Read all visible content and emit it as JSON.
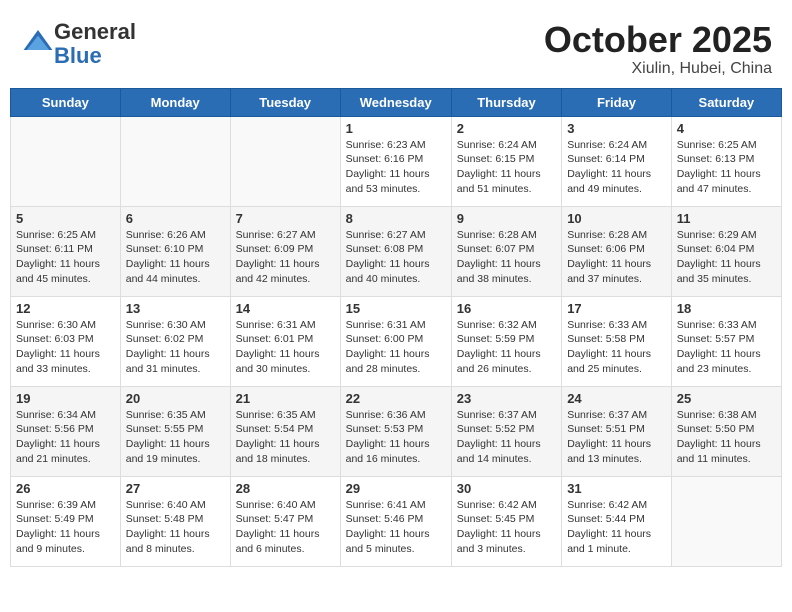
{
  "header": {
    "logo_general": "General",
    "logo_blue": "Blue",
    "title": "October 2025",
    "subtitle": "Xiulin, Hubei, China"
  },
  "weekdays": [
    "Sunday",
    "Monday",
    "Tuesday",
    "Wednesday",
    "Thursday",
    "Friday",
    "Saturday"
  ],
  "weeks": [
    [
      {
        "day": null,
        "info": null
      },
      {
        "day": null,
        "info": null
      },
      {
        "day": null,
        "info": null
      },
      {
        "day": "1",
        "info": "Sunrise: 6:23 AM\nSunset: 6:16 PM\nDaylight: 11 hours\nand 53 minutes."
      },
      {
        "day": "2",
        "info": "Sunrise: 6:24 AM\nSunset: 6:15 PM\nDaylight: 11 hours\nand 51 minutes."
      },
      {
        "day": "3",
        "info": "Sunrise: 6:24 AM\nSunset: 6:14 PM\nDaylight: 11 hours\nand 49 minutes."
      },
      {
        "day": "4",
        "info": "Sunrise: 6:25 AM\nSunset: 6:13 PM\nDaylight: 11 hours\nand 47 minutes."
      }
    ],
    [
      {
        "day": "5",
        "info": "Sunrise: 6:25 AM\nSunset: 6:11 PM\nDaylight: 11 hours\nand 45 minutes."
      },
      {
        "day": "6",
        "info": "Sunrise: 6:26 AM\nSunset: 6:10 PM\nDaylight: 11 hours\nand 44 minutes."
      },
      {
        "day": "7",
        "info": "Sunrise: 6:27 AM\nSunset: 6:09 PM\nDaylight: 11 hours\nand 42 minutes."
      },
      {
        "day": "8",
        "info": "Sunrise: 6:27 AM\nSunset: 6:08 PM\nDaylight: 11 hours\nand 40 minutes."
      },
      {
        "day": "9",
        "info": "Sunrise: 6:28 AM\nSunset: 6:07 PM\nDaylight: 11 hours\nand 38 minutes."
      },
      {
        "day": "10",
        "info": "Sunrise: 6:28 AM\nSunset: 6:06 PM\nDaylight: 11 hours\nand 37 minutes."
      },
      {
        "day": "11",
        "info": "Sunrise: 6:29 AM\nSunset: 6:04 PM\nDaylight: 11 hours\nand 35 minutes."
      }
    ],
    [
      {
        "day": "12",
        "info": "Sunrise: 6:30 AM\nSunset: 6:03 PM\nDaylight: 11 hours\nand 33 minutes."
      },
      {
        "day": "13",
        "info": "Sunrise: 6:30 AM\nSunset: 6:02 PM\nDaylight: 11 hours\nand 31 minutes."
      },
      {
        "day": "14",
        "info": "Sunrise: 6:31 AM\nSunset: 6:01 PM\nDaylight: 11 hours\nand 30 minutes."
      },
      {
        "day": "15",
        "info": "Sunrise: 6:31 AM\nSunset: 6:00 PM\nDaylight: 11 hours\nand 28 minutes."
      },
      {
        "day": "16",
        "info": "Sunrise: 6:32 AM\nSunset: 5:59 PM\nDaylight: 11 hours\nand 26 minutes."
      },
      {
        "day": "17",
        "info": "Sunrise: 6:33 AM\nSunset: 5:58 PM\nDaylight: 11 hours\nand 25 minutes."
      },
      {
        "day": "18",
        "info": "Sunrise: 6:33 AM\nSunset: 5:57 PM\nDaylight: 11 hours\nand 23 minutes."
      }
    ],
    [
      {
        "day": "19",
        "info": "Sunrise: 6:34 AM\nSunset: 5:56 PM\nDaylight: 11 hours\nand 21 minutes."
      },
      {
        "day": "20",
        "info": "Sunrise: 6:35 AM\nSunset: 5:55 PM\nDaylight: 11 hours\nand 19 minutes."
      },
      {
        "day": "21",
        "info": "Sunrise: 6:35 AM\nSunset: 5:54 PM\nDaylight: 11 hours\nand 18 minutes."
      },
      {
        "day": "22",
        "info": "Sunrise: 6:36 AM\nSunset: 5:53 PM\nDaylight: 11 hours\nand 16 minutes."
      },
      {
        "day": "23",
        "info": "Sunrise: 6:37 AM\nSunset: 5:52 PM\nDaylight: 11 hours\nand 14 minutes."
      },
      {
        "day": "24",
        "info": "Sunrise: 6:37 AM\nSunset: 5:51 PM\nDaylight: 11 hours\nand 13 minutes."
      },
      {
        "day": "25",
        "info": "Sunrise: 6:38 AM\nSunset: 5:50 PM\nDaylight: 11 hours\nand 11 minutes."
      }
    ],
    [
      {
        "day": "26",
        "info": "Sunrise: 6:39 AM\nSunset: 5:49 PM\nDaylight: 11 hours\nand 9 minutes."
      },
      {
        "day": "27",
        "info": "Sunrise: 6:40 AM\nSunset: 5:48 PM\nDaylight: 11 hours\nand 8 minutes."
      },
      {
        "day": "28",
        "info": "Sunrise: 6:40 AM\nSunset: 5:47 PM\nDaylight: 11 hours\nand 6 minutes."
      },
      {
        "day": "29",
        "info": "Sunrise: 6:41 AM\nSunset: 5:46 PM\nDaylight: 11 hours\nand 5 minutes."
      },
      {
        "day": "30",
        "info": "Sunrise: 6:42 AM\nSunset: 5:45 PM\nDaylight: 11 hours\nand 3 minutes."
      },
      {
        "day": "31",
        "info": "Sunrise: 6:42 AM\nSunset: 5:44 PM\nDaylight: 11 hours\nand 1 minute."
      },
      {
        "day": null,
        "info": null
      }
    ]
  ]
}
